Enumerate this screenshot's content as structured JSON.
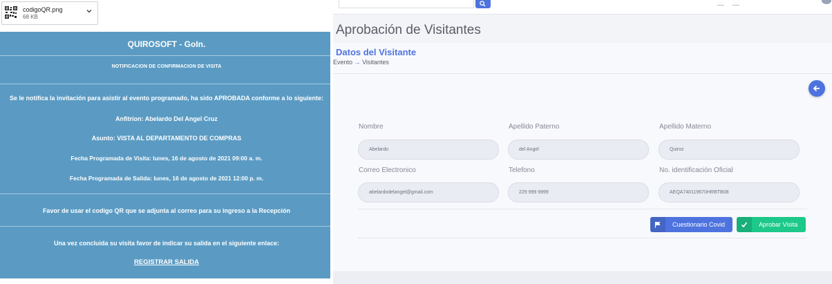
{
  "download": {
    "file_name": "codigoQR.png",
    "file_size": "68 KB"
  },
  "email": {
    "title": "QUIROSOFT - GoIn.",
    "subtitle": "NOTIFICACION DE CONFIRMACION DE VISITA",
    "intro": "Se le notifica la invitación para asistir al evento programado, ha sido APROBADA conforme a lo siguiente:",
    "host": "Anfitrion: Abelardo Del Angel Cruz",
    "subject": "Asunto: VISTA AL DEPARTAMENTO DE COMPRAS",
    "visit_date": "Fecha Programada de Visita: lunes, 16 de agosto de 2021 09:00 a. m.",
    "exit_date": "Fecha Programada de Salida: lunes, 16 de agosto de 2021 12:00 p. m.",
    "qr_note": "Favor de usar el codigo QR que se adjunta al correo para su ingreso a la Recepción",
    "end_note": "Una vez concluida su visita favor de indicar su salida en el siguiente enlace:",
    "link_label": "REGISTRAR SALIDA"
  },
  "app": {
    "page_title": "Aprobación de Visitantes",
    "card_title": "Datos del Visitante",
    "breadcrumb_from": "Evento",
    "breadcrumb_arrow": "→",
    "breadcrumb_to": "Visitantes",
    "fields": {
      "nombre": {
        "label": "Nombre",
        "value": "Abelardo"
      },
      "apellido_paterno": {
        "label": "Apellido Paterno",
        "value": "del Angel"
      },
      "apellido_materno": {
        "label": "Apellido Materno",
        "value": "Quiroz"
      },
      "correo": {
        "label": "Correo Electronico",
        "value": "abelardodelangel@gmail.com"
      },
      "telefono": {
        "label": "Telefono",
        "value": "229 999 9999"
      },
      "identificacion": {
        "label": "No. identificación Oficial",
        "value": "AEQA740119670HRBTB08"
      }
    },
    "buttons": {
      "covid": "Cuestionario Covid",
      "aprobar": "Aprobar Visita"
    }
  },
  "colors": {
    "email_bg": "#5b9bc3",
    "primary": "#4e73df",
    "success": "#1cc88a"
  }
}
